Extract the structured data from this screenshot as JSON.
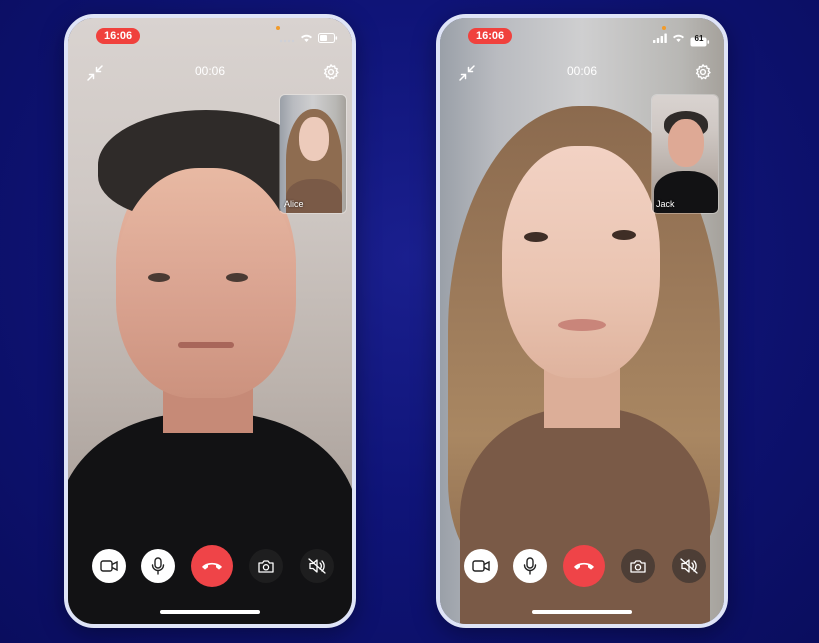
{
  "calls": [
    {
      "status_time": "16:06",
      "duration": "00:06",
      "pip_name": "Alice"
    },
    {
      "status_time": "16:06",
      "duration": "00:06",
      "pip_name": "Jack",
      "battery_level": "61"
    }
  ],
  "colors": {
    "background": "#0f1478",
    "hangup": "#ef4448",
    "time_pill": "#f0413d",
    "phone_frame": "#dfe4f7"
  },
  "icons": {
    "minimize": "minimize-icon",
    "settings": "gear-icon",
    "camera_toggle": "video-camera-icon",
    "microphone": "microphone-icon",
    "hangup": "phone-hangup-icon",
    "flip_camera": "camera-flip-icon",
    "speaker_mute": "speaker-muted-icon"
  }
}
